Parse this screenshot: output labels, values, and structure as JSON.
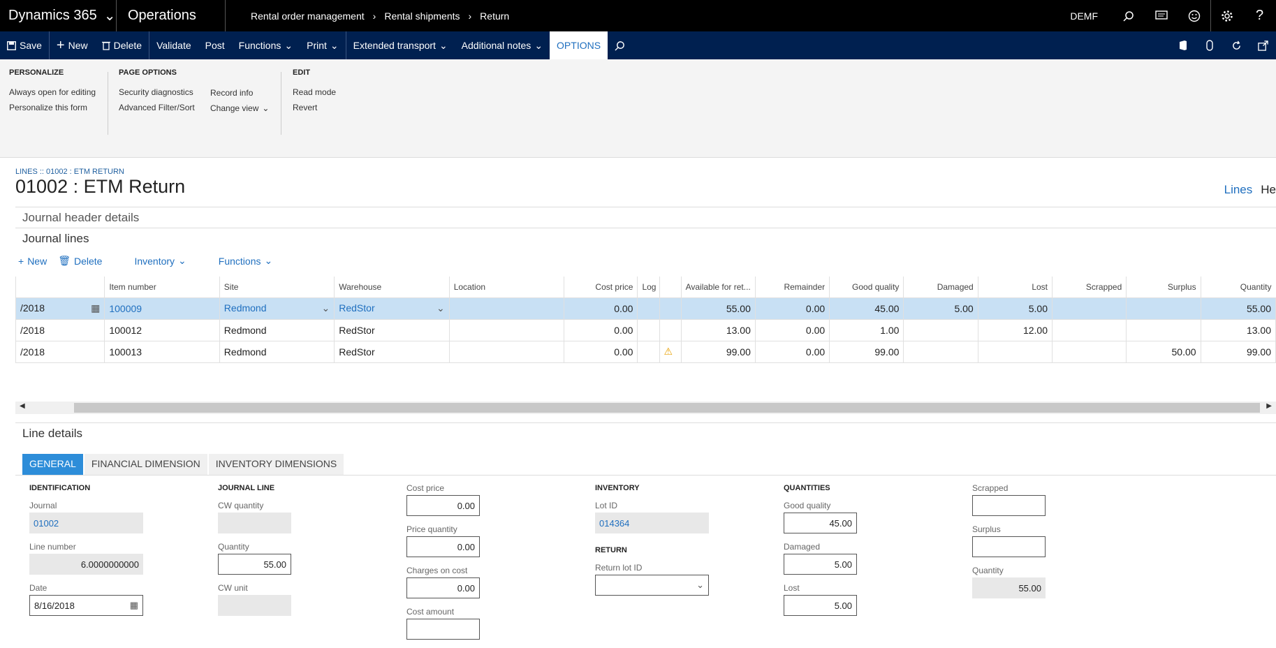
{
  "topbar": {
    "product": "Dynamics 365",
    "app": "Operations",
    "breadcrumbs": [
      "Rental order management",
      "Rental shipments",
      "Return"
    ],
    "company": "DEMF"
  },
  "actionbar": {
    "save": "Save",
    "new": "New",
    "delete": "Delete",
    "validate": "Validate",
    "post": "Post",
    "functions": "Functions",
    "print": "Print",
    "extended_transport": "Extended transport",
    "additional_notes": "Additional notes",
    "options": "OPTIONS"
  },
  "ribbon": {
    "personalize": {
      "title": "PERSONALIZE",
      "items": [
        "Always open for editing",
        "Personalize this form"
      ]
    },
    "page_options": {
      "title": "PAGE OPTIONS",
      "items": [
        "Security diagnostics",
        "Advanced Filter/Sort",
        "Record info",
        "Change view"
      ]
    },
    "edit": {
      "title": "EDIT",
      "items": [
        "Read mode",
        "Revert"
      ]
    }
  },
  "page": {
    "breadcrumb": "LINES :: 01002 : ETM RETURN",
    "title": "01002 : ETM Return",
    "view_lines": "Lines",
    "view_header": "He"
  },
  "journal_header": "Journal header details",
  "journal_lines": {
    "title": "Journal lines",
    "toolbar": {
      "new": "New",
      "delete": "Delete",
      "inventory": "Inventory",
      "functions": "Functions"
    },
    "columns": [
      "",
      "Item number",
      "Site",
      "Warehouse",
      "Location",
      "Cost price",
      "Log",
      "",
      "Available for ret...",
      "Remainder",
      "Good quality",
      "Damaged",
      "Lost",
      "Scrapped",
      "Surplus",
      "Quantity"
    ],
    "rows": [
      [
        "/2018",
        "100009",
        "Redmond",
        "RedStor",
        "",
        "0.00",
        "",
        "",
        "55.00",
        "0.00",
        "45.00",
        "5.00",
        "5.00",
        "",
        "",
        "55.00"
      ],
      [
        "/2018",
        "100012",
        "Redmond",
        "RedStor",
        "",
        "0.00",
        "",
        "",
        "13.00",
        "0.00",
        "1.00",
        "",
        "12.00",
        "",
        "",
        "13.00"
      ],
      [
        "/2018",
        "100013",
        "Redmond",
        "RedStor",
        "",
        "0.00",
        "",
        "⚠",
        "99.00",
        "0.00",
        "99.00",
        "",
        "",
        "",
        "50.00",
        "99.00"
      ]
    ]
  },
  "line_details": {
    "title": "Line details",
    "tabs": [
      "GENERAL",
      "FINANCIAL DIMENSION",
      "INVENTORY DIMENSIONS"
    ],
    "identification": {
      "title": "IDENTIFICATION",
      "journal_label": "Journal",
      "journal": "01002",
      "line_number_label": "Line number",
      "line_number": "6.0000000000",
      "date_label": "Date",
      "date": "8/16/2018"
    },
    "journal_line": {
      "title": "JOURNAL LINE",
      "cw_quantity_label": "CW quantity",
      "cw_quantity": "",
      "quantity_label": "Quantity",
      "quantity": "55.00",
      "cw_unit_label": "CW unit",
      "cw_unit": ""
    },
    "costs": {
      "cost_price_label": "Cost price",
      "cost_price": "0.00",
      "price_quantity_label": "Price quantity",
      "price_quantity": "0.00",
      "charges_label": "Charges on cost",
      "charges": "0.00",
      "cost_amount_label": "Cost amount"
    },
    "inventory": {
      "title": "INVENTORY",
      "lot_id_label": "Lot ID",
      "lot_id": "014364",
      "return_title": "RETURN",
      "return_lot_label": "Return lot ID",
      "return_lot": ""
    },
    "quantities": {
      "title": "QUANTITIES",
      "good_label": "Good quality",
      "good": "45.00",
      "damaged_label": "Damaged",
      "damaged": "5.00",
      "lost_label": "Lost",
      "lost": "5.00"
    },
    "other": {
      "scrapped_label": "Scrapped",
      "scrapped": "",
      "surplus_label": "Surplus",
      "surplus": "",
      "quantity_label": "Quantity",
      "quantity": "55.00"
    }
  }
}
